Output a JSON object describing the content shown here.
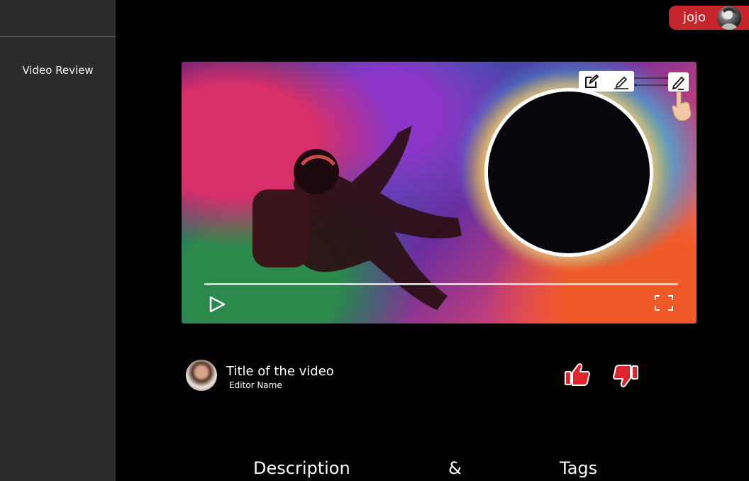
{
  "sidebar": {
    "items": [
      {
        "label": "Video Review"
      }
    ]
  },
  "user": {
    "name": "jojo",
    "avatar_icon": "user-avatar",
    "chip_color": "#c8242b"
  },
  "player": {
    "progress": 0,
    "controls": {
      "play_icon": "play-icon",
      "fullscreen_icon": "fullscreen-icon"
    },
    "annotation_tools": [
      {
        "icon": "edit-icon"
      },
      {
        "icon": "signature-icon"
      },
      {
        "icon": "pen-icon"
      }
    ]
  },
  "video": {
    "title": "Title of the video",
    "editor": "Editor Name",
    "reactions": {
      "like_icon": "thumbs-up-icon",
      "dislike_icon": "thumbs-down-icon",
      "accent": "#e0242c"
    }
  },
  "sections": {
    "description": "Description",
    "ampersand": "&",
    "tags": "Tags"
  }
}
